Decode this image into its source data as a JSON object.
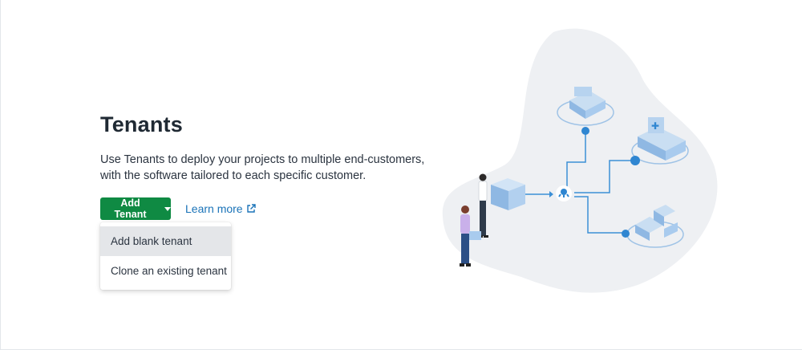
{
  "page": {
    "title": "Tenants",
    "description": "Use Tenants to deploy your projects to multiple end-customers, with the software tailored to each specific customer."
  },
  "actions": {
    "add_tenant_label": "Add Tenant",
    "learn_more_label": "Learn more"
  },
  "dropdown": {
    "items": [
      {
        "label": "Add blank tenant"
      },
      {
        "label": "Clone an existing tenant"
      }
    ]
  },
  "colors": {
    "primary_button": "#0f8a43",
    "link": "#1a73b8",
    "illustration_blob": "#eef0f3",
    "illustration_accent": "#3b8fd6"
  },
  "icons": [
    "caret-down-icon",
    "external-link-icon"
  ]
}
